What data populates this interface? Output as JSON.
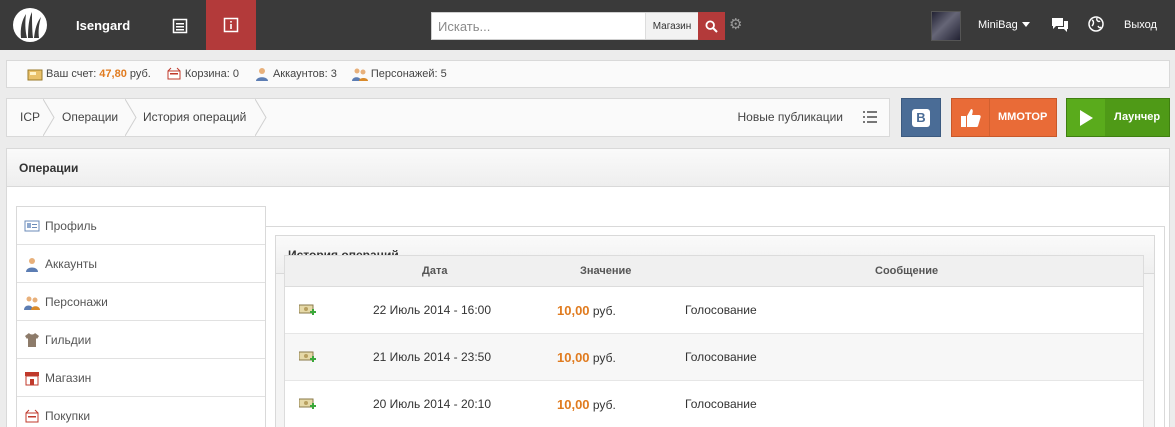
{
  "topbar": {
    "brand": "Isengard",
    "search_placeholder": "Искать...",
    "search_scope": "Магазин",
    "user_name": "MiniBag",
    "logout": "Выход"
  },
  "account": {
    "balance_label": "Ваш счет:",
    "balance_value": "47,80",
    "balance_currency": "руб.",
    "cart": "Корзина: 0",
    "accounts": "Аккаунтов: 3",
    "characters": "Персонажей: 5"
  },
  "breadcrumb": {
    "items": [
      "ICP",
      "Операции",
      "История операций"
    ],
    "new_posts": "Новые публикации"
  },
  "promo": {
    "vk": "B",
    "mmotop": "MMOTOP",
    "launcher": "Лаунчер"
  },
  "panel": {
    "title": "Операции"
  },
  "sidebar": {
    "items": [
      {
        "label": "Профиль",
        "icon": "profile-card-icon"
      },
      {
        "label": "Аккаунты",
        "icon": "user-icon"
      },
      {
        "label": "Персонажи",
        "icon": "users-icon"
      },
      {
        "label": "Гильдии",
        "icon": "guild-shirt-icon"
      },
      {
        "label": "Магазин",
        "icon": "shop-icon"
      },
      {
        "label": "Покупки",
        "icon": "cart-icon"
      }
    ]
  },
  "history": {
    "title": "История операций",
    "columns": [
      "Дата",
      "Значение",
      "Сообщение"
    ],
    "rows": [
      {
        "date": "22 Июль 2014 - 16:00",
        "amount": "10,00",
        "currency": "руб.",
        "message": "Голосование"
      },
      {
        "date": "21 Июль 2014 - 23:50",
        "amount": "10,00",
        "currency": "руб.",
        "message": "Голосование"
      },
      {
        "date": "20 Июль 2014 - 20:10",
        "amount": "10,00",
        "currency": "руб.",
        "message": "Голосование"
      }
    ]
  },
  "colors": {
    "topbar": "#3a3a3a",
    "accent_red": "#b33a3a",
    "amount_orange": "#e07b1f",
    "mmotop_orange": "#e96b37",
    "launcher_green": "#4f9a17",
    "vk_blue": "#4a6c96"
  }
}
